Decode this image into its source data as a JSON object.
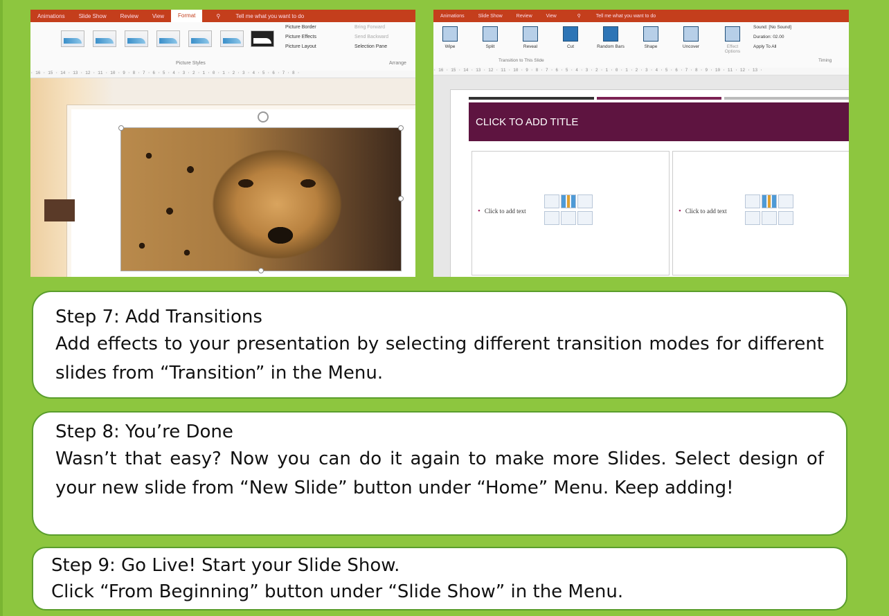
{
  "left_screenshot": {
    "tabs": [
      "Animations",
      "Slide Show",
      "Review",
      "View",
      "Format",
      "Tell me what you want to do"
    ],
    "active_tab": "Format",
    "ribbon_items": [
      "Picture Border",
      "Picture Effects",
      "Picture Layout",
      "Bring Forward",
      "Send Backward",
      "Selection Pane"
    ],
    "group_label": "Picture Styles",
    "group_label_2": "Arrange"
  },
  "right_screenshot": {
    "tabs": [
      "Animations",
      "Slide Show",
      "Review",
      "View",
      "Tell me what you want to do"
    ],
    "transitions": [
      "Wipe",
      "Split",
      "Reveal",
      "Cut",
      "Random Bars",
      "Shape",
      "Uncover"
    ],
    "effect_options": "Effect Options",
    "group_label": "Transition to This Slide",
    "timing_label": "Timing",
    "sound_label": "Sound:",
    "sound_value": "[No Sound]",
    "duration_label": "Duration:",
    "duration_value": "02.00",
    "apply_all": "Apply To All",
    "slide_title": "CLICK TO ADD TITLE",
    "placeholder_text": "Click to add text"
  },
  "steps": [
    {
      "heading": "Step 7: Add Transitions",
      "text": "Add effects to your presentation by selecting different transition modes for different slides from “Transition” in the Menu."
    },
    {
      "heading": "Step 8: You’re Done",
      "text": "Wasn’t that easy? Now you can do it again to make more Slides. Select design of your new slide from “New Slide” button under “Home” Menu. Keep adding!"
    },
    {
      "heading": "Step 9: Go Live! Start your Slide Show.",
      "text": "Click “From Beginning” button under “Slide Show” in the Menu."
    }
  ]
}
